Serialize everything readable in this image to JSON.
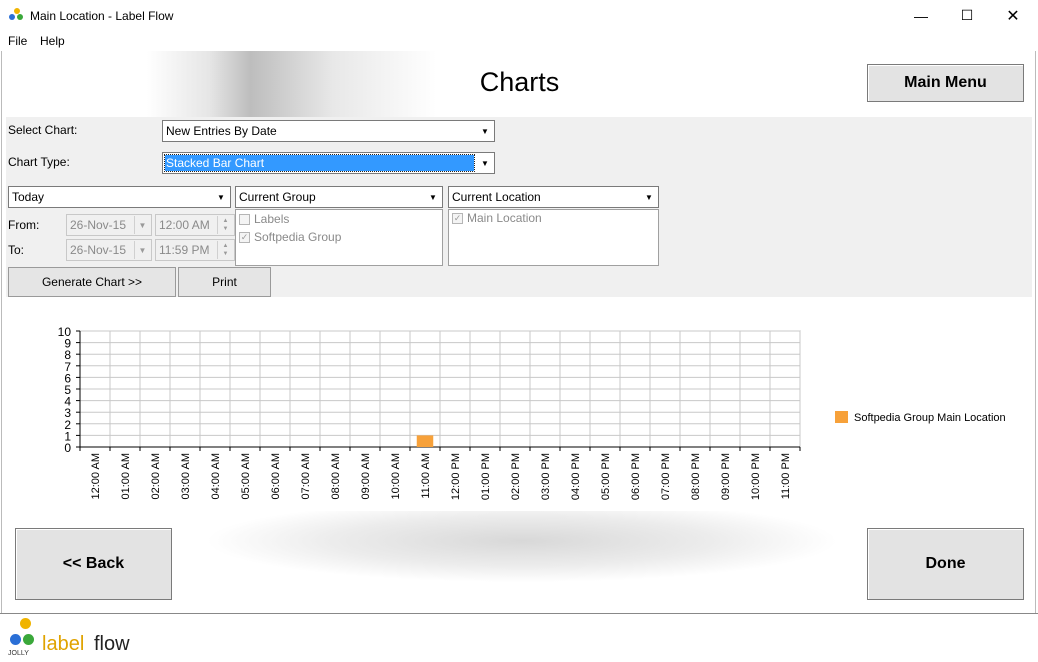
{
  "window": {
    "title": "Main Location - Label Flow"
  },
  "menu": [
    "File",
    "Help"
  ],
  "page": {
    "title": "Charts"
  },
  "buttons": {
    "main_menu": "Main Menu",
    "back": "<< Back",
    "done": "Done",
    "generate": "Generate Chart >>",
    "print": "Print"
  },
  "form": {
    "select_chart_label": "Select Chart:",
    "select_chart_value": "New Entries By Date",
    "chart_type_label": "Chart Type:",
    "chart_type_value": "Stacked Bar Chart",
    "period_value": "Today",
    "group_value": "Current Group",
    "location_value": "Current Location",
    "from_label": "From:",
    "to_label": "To:",
    "from_date": "26-Nov-15",
    "from_time": "12:00 AM",
    "to_date": "26-Nov-15",
    "to_time": "11:59 PM"
  },
  "group_list": [
    {
      "label": "Labels",
      "checked": false
    },
    {
      "label": "Softpedia Group",
      "checked": true
    }
  ],
  "location_list": [
    {
      "label": "Main Location",
      "checked": true
    }
  ],
  "chart_data": {
    "type": "bar",
    "stacked": true,
    "categories": [
      "12:00 AM",
      "01:00 AM",
      "02:00 AM",
      "03:00 AM",
      "04:00 AM",
      "05:00 AM",
      "06:00 AM",
      "07:00 AM",
      "08:00 AM",
      "09:00 AM",
      "10:00 AM",
      "11:00 AM",
      "12:00 PM",
      "01:00 PM",
      "02:00 PM",
      "03:00 PM",
      "04:00 PM",
      "05:00 PM",
      "06:00 PM",
      "07:00 PM",
      "08:00 PM",
      "09:00 PM",
      "10:00 PM",
      "11:00 PM"
    ],
    "series": [
      {
        "name": "Softpedia Group Main Location",
        "color": "#f7a13a",
        "values": [
          0,
          0,
          0,
          0,
          0,
          0,
          0,
          0,
          0,
          0,
          0,
          1,
          0,
          0,
          0,
          0,
          0,
          0,
          0,
          0,
          0,
          0,
          0,
          0
        ]
      }
    ],
    "yticks": [
      "0",
      "1",
      "2",
      "3",
      "4",
      "5",
      "6",
      "7",
      "8",
      "9",
      "10"
    ],
    "ylim": [
      0,
      10
    ],
    "grid": true,
    "legend_position": "right"
  },
  "logo": {
    "jolly": "JOLLY",
    "label": "label",
    "flow": "flow"
  }
}
